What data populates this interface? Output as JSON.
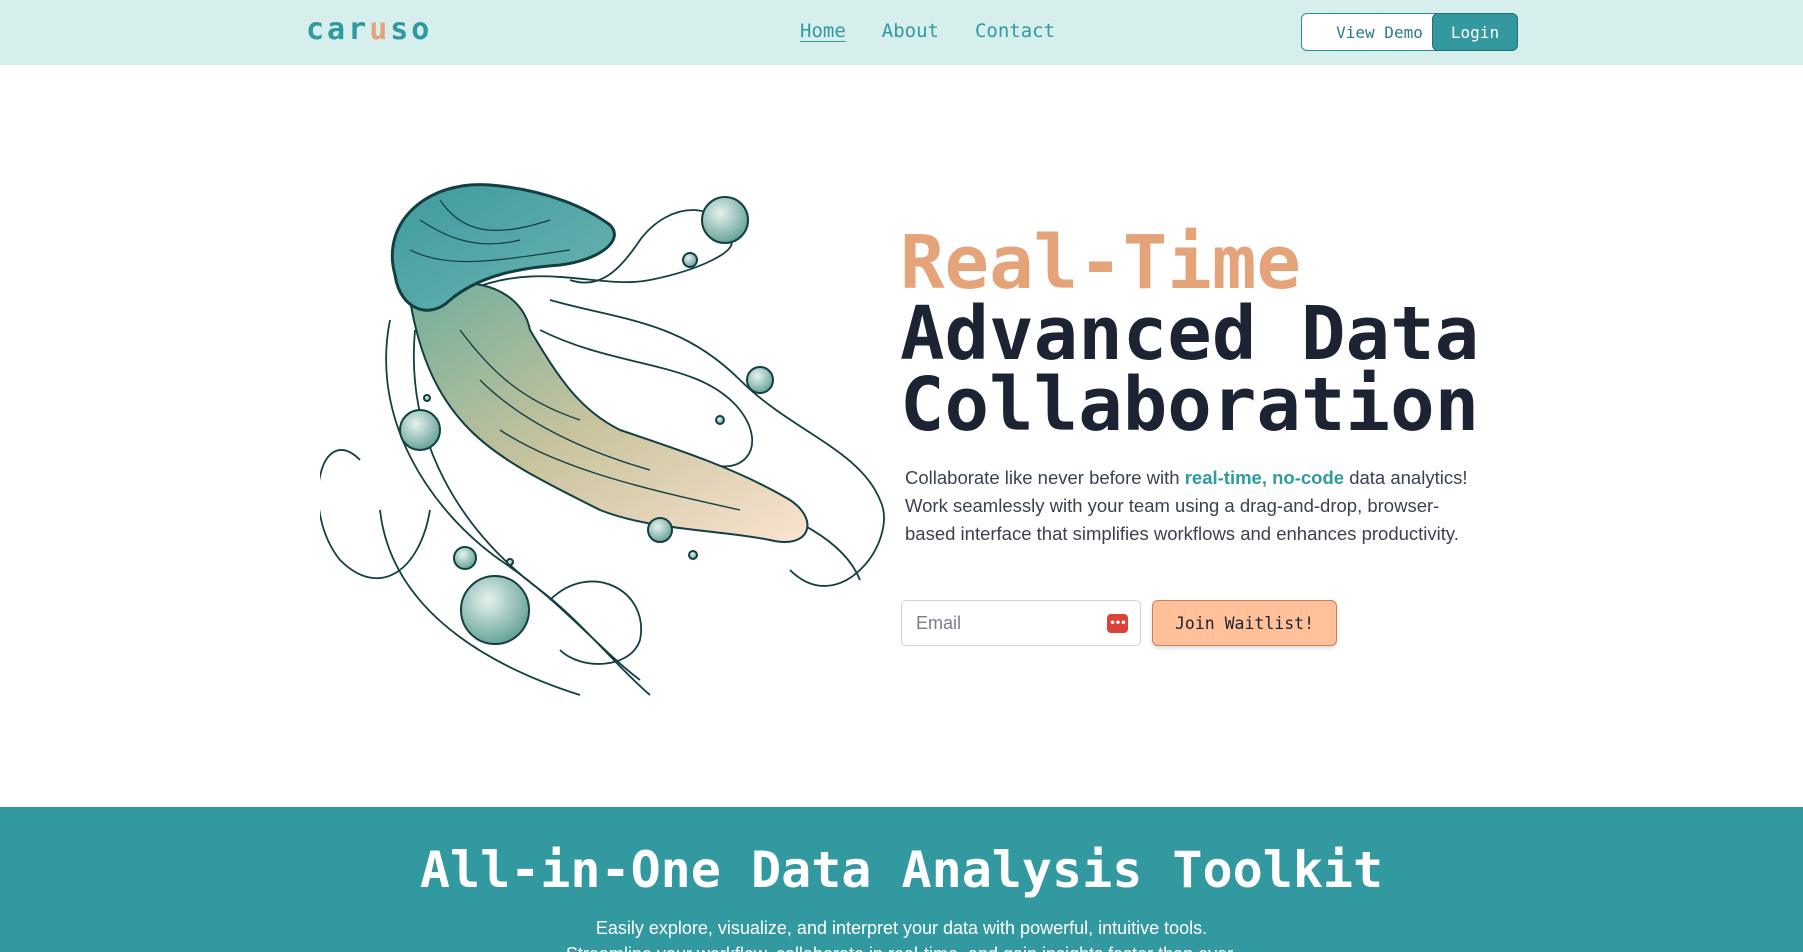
{
  "nav": {
    "logo_part1": "car",
    "logo_accent": "u",
    "logo_part2": "so",
    "links": [
      "Home",
      "About",
      "Contact"
    ],
    "view_demo_label": "View Demo",
    "login_label": "Login"
  },
  "hero": {
    "title_line1": "Real-Time",
    "title_line2": "Advanced Data",
    "title_line3": "Collaboration",
    "desc_before": "Collaborate like never before with ",
    "desc_highlight": "real-time, no-code",
    "desc_after": " data analytics! Work seamlessly with your team using a drag-and-drop, browser-based interface that simplifies workflows and enhances productivity.",
    "email_placeholder": "Email",
    "join_label": "Join Waitlist!",
    "illustration_icon": "jellyfish-illustration"
  },
  "toolkit": {
    "title": "All-in-One Data Analysis Toolkit",
    "desc_line1": "Easily explore, visualize, and interpret your data with powerful, intuitive tools.",
    "desc_line2": "Streamline your workflow, collaborate in real-time, and gain insights faster than ever."
  },
  "colors": {
    "nav_bg": "#d6efec",
    "brand_teal": "#33999f",
    "accent_peach": "#e5a37a",
    "join_button": "#ffc09a",
    "title_dark": "#1c2434"
  }
}
